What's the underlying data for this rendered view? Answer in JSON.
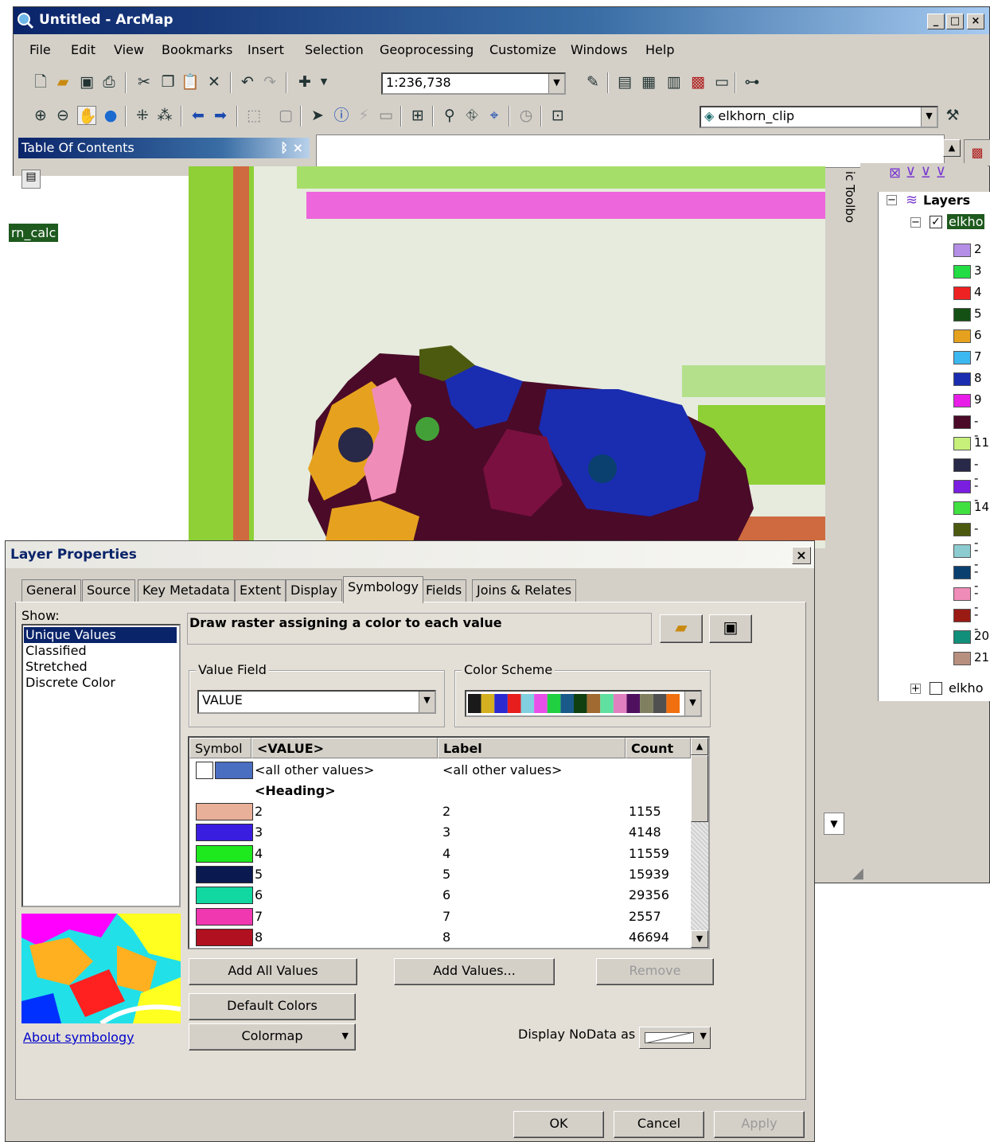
{
  "window": {
    "title": "Untitled - ArcMap",
    "controls": [
      "_",
      "□",
      "×"
    ]
  },
  "menu": [
    "File",
    "Edit",
    "View",
    "Bookmarks",
    "Insert",
    "Selection",
    "Geoprocessing",
    "Customize",
    "Windows",
    "Help"
  ],
  "toolbar": {
    "scale": "1:236,738",
    "layer_select": "elkhorn_clip"
  },
  "toc": {
    "title": "Table Of Contents",
    "pin": "ᛒ ×",
    "layer_label": "rn_calc"
  },
  "side_label": "ic Toolbo",
  "layers_tree": {
    "root": "Layers",
    "layer1": "elkho",
    "layer2": "elkho",
    "legend": [
      {
        "label": "2",
        "color": "#b58ee6"
      },
      {
        "label": "3",
        "color": "#22dd44"
      },
      {
        "label": "4",
        "color": "#ee2222"
      },
      {
        "label": "5",
        "color": "#145014"
      },
      {
        "label": "6",
        "color": "#e6a21e"
      },
      {
        "label": "7",
        "color": "#3cb8f0"
      },
      {
        "label": "8",
        "color": "#1a2cb0"
      },
      {
        "label": "9",
        "color": "#e81ee8"
      },
      {
        "label": "- -",
        "color": "#4a0a28"
      },
      {
        "label": "11",
        "color": "#c6f07a"
      },
      {
        "label": "- -",
        "color": "#282848"
      },
      {
        "label": "- -",
        "color": "#7a1ee0"
      },
      {
        "label": "14",
        "color": "#40e040"
      },
      {
        "label": "- -",
        "color": "#4c5a10"
      },
      {
        "label": "- -",
        "color": "#8cccd0"
      },
      {
        "label": "- -",
        "color": "#0a4070"
      },
      {
        "label": "- -",
        "color": "#f08cb8"
      },
      {
        "label": "- -",
        "color": "#9a1a14"
      },
      {
        "label": "20",
        "color": "#10907a"
      },
      {
        "label": "21",
        "color": "#b89080"
      }
    ]
  },
  "dialog": {
    "title": "Layer Properties",
    "close": "×",
    "tabs": [
      "General",
      "Source",
      "Key Metadata",
      "Extent",
      "Display",
      "Symbology",
      "Fields",
      "Joins & Relates"
    ],
    "active_tab": "Symbology",
    "show_label": "Show:",
    "show_items": [
      "Unique Values",
      "Classified",
      "Stretched",
      "Discrete Color"
    ],
    "selected_show": "Unique Values",
    "description": "Draw raster assigning a color to each value",
    "value_field_label": "Value Field",
    "value_field": "VALUE",
    "color_scheme_label": "Color Scheme",
    "color_scheme": [
      "#1a1a1a",
      "#d4b020",
      "#2a2ad0",
      "#e81e1e",
      "#80d0e0",
      "#e84ee8",
      "#20d040",
      "#1a5a8a",
      "#104010",
      "#a06a30",
      "#60e0a0",
      "#e080c0",
      "#501060",
      "#808060",
      "#505050",
      "#f07010"
    ],
    "grid": {
      "headers": [
        "Symbol",
        "<VALUE>",
        "Label",
        "Count"
      ],
      "all_other": {
        "value": "<all other values>",
        "label": "<all other values>",
        "color": "#4a6ec0"
      },
      "heading": "<Heading>",
      "rows": [
        {
          "value": "2",
          "label": "2",
          "count": "1155",
          "color": "#e8b098"
        },
        {
          "value": "3",
          "label": "3",
          "count": "4148",
          "color": "#3a1ee0"
        },
        {
          "value": "4",
          "label": "4",
          "count": "11559",
          "color": "#1ee81e"
        },
        {
          "value": "5",
          "label": "5",
          "count": "15939",
          "color": "#0a1a50"
        },
        {
          "value": "6",
          "label": "6",
          "count": "29356",
          "color": "#10d8a0"
        },
        {
          "value": "7",
          "label": "7",
          "count": "2557",
          "color": "#f038b0"
        },
        {
          "value": "8",
          "label": "8",
          "count": "46694",
          "color": "#b01020"
        }
      ]
    },
    "buttons": {
      "add_all": "Add All Values",
      "add_values": "Add Values...",
      "remove": "Remove",
      "default_colors": "Default Colors",
      "colormap": "Colormap",
      "ok": "OK",
      "cancel": "Cancel",
      "apply": "Apply"
    },
    "about_link": "About symbology",
    "nodata_label": "Display NoData as"
  }
}
